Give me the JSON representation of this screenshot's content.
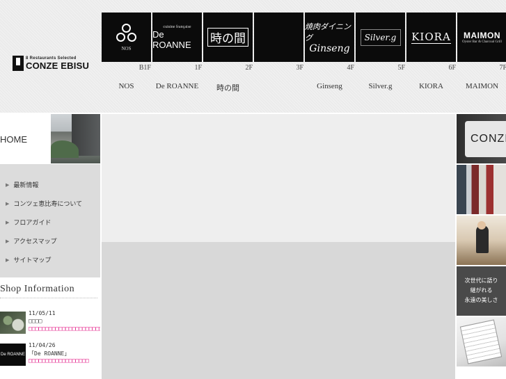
{
  "brand": {
    "sub": "8 Restaurants Selected",
    "name": "CONZE EBISU"
  },
  "floors": [
    {
      "level": "B1F",
      "name": "NOS",
      "tile": {
        "top": "",
        "main": "NOS"
      }
    },
    {
      "level": "1F",
      "name": "De ROANNE",
      "tile": {
        "top": "cuisine française",
        "main": "De ROANNE"
      }
    },
    {
      "level": "2F",
      "name": "時の間",
      "tile": {
        "top": "",
        "main": "時の間"
      }
    },
    {
      "level": "3F",
      "name": "",
      "tile": {
        "top": "",
        "main": ""
      }
    },
    {
      "level": "4F",
      "name": "Ginseng",
      "tile": {
        "top": "焼肉ダイニング",
        "main": "Ginseng"
      }
    },
    {
      "level": "5F",
      "name": "Silver.g",
      "tile": {
        "top": "",
        "main": "Silver.g"
      }
    },
    {
      "level": "6F",
      "name": "KIORA",
      "tile": {
        "top": "",
        "main": "KIORA"
      }
    },
    {
      "level": "7F",
      "name": "MAIMON",
      "tile": {
        "top": "MAIMON",
        "main": "Oyster Bar & Charcoal Grill"
      }
    }
  ],
  "sidebar": {
    "home_label": "HOME",
    "menu": [
      {
        "label": "最新情報"
      },
      {
        "label": "コンツェ恵比寿について"
      },
      {
        "label": "フロアガイド"
      },
      {
        "label": "アクセスマップ"
      },
      {
        "label": "サイトマップ"
      }
    ],
    "shop_info_title": "Shop Information",
    "news": [
      {
        "date": "11/05/11",
        "title": "□□□□",
        "link": "□□□□□□□□□□□□□□□□□□□□□□"
      },
      {
        "date": "11/04/26",
        "title": "「De ROANNE」",
        "link": "□□□□□□□□□□□□□□□□□□",
        "thumb_text": "De ROANNE"
      }
    ]
  },
  "rail": {
    "conze_text": "CONZE",
    "slogan": [
      "次世代に語り",
      "継がれる",
      "永遠の美しさ"
    ]
  },
  "colors": {
    "accent_link": "#e0007a",
    "menu_bg": "#dcdcdc",
    "tile_bg": "#0b0b0b"
  }
}
